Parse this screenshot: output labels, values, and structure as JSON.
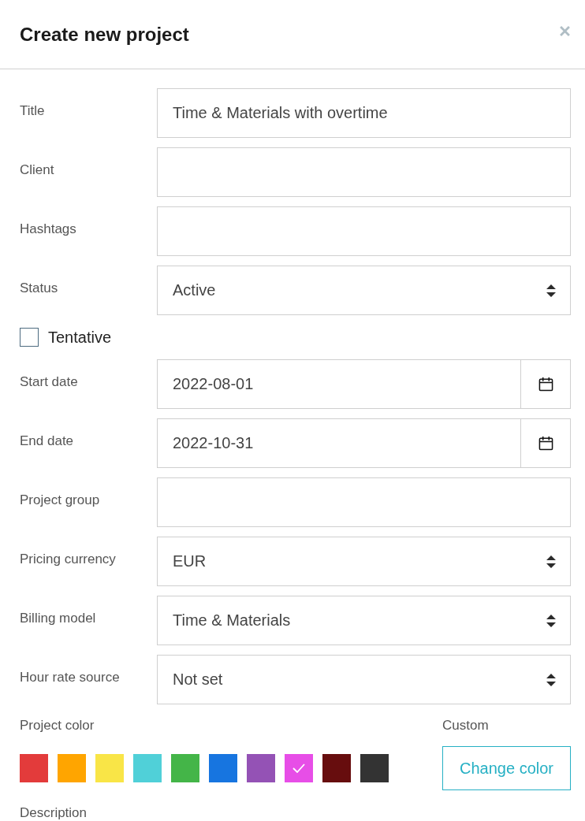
{
  "dialog": {
    "title": "Create new project"
  },
  "fields": [
    {
      "kind": "text",
      "label": "Title",
      "value": "Time & Materials with overtime"
    },
    {
      "kind": "text",
      "label": "Client"
    },
    {
      "kind": "text",
      "label": "Hashtags"
    },
    {
      "kind": "select",
      "label": "Status",
      "value": "Active"
    },
    {
      "kind": "checkbox",
      "label": "Tentative",
      "checked": false
    },
    {
      "kind": "date",
      "label": "Start date",
      "value": "2022-08-01"
    },
    {
      "kind": "date",
      "label": "End date",
      "value": "2022-10-31"
    },
    {
      "kind": "text",
      "label": "Project group"
    },
    {
      "kind": "select",
      "label": "Pricing currency",
      "value": "EUR"
    },
    {
      "kind": "select",
      "label": "Billing model",
      "value": "Time & Materials"
    },
    {
      "kind": "select",
      "label": "Hour rate source",
      "value": "Not set"
    }
  ],
  "project_color": {
    "label": "Project color",
    "swatches": [
      {
        "color": "#e33b3b",
        "selected": false
      },
      {
        "color": "#ffa500",
        "selected": false
      },
      {
        "color": "#f9e547",
        "selected": false
      },
      {
        "color": "#50d0d8",
        "selected": false
      },
      {
        "color": "#44b548",
        "selected": false
      },
      {
        "color": "#1775e0",
        "selected": false
      },
      {
        "color": "#9452b5",
        "selected": false
      },
      {
        "color": "#e74ee7",
        "selected": true
      },
      {
        "color": "#670d0e",
        "selected": false
      },
      {
        "color": "#333333",
        "selected": false
      }
    ]
  },
  "custom_color": {
    "label": "Custom",
    "button": "Change color"
  },
  "description": {
    "label": "Description"
  }
}
